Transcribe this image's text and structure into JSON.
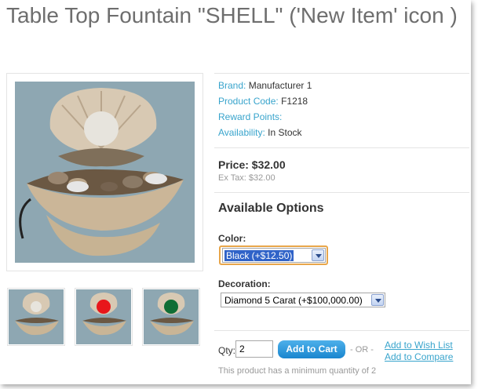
{
  "product": {
    "title": "Table Top Fountain \"SHELL\" ('New Item' icon )",
    "details": [
      {
        "key": "Brand:",
        "value": "Manufacturer 1"
      },
      {
        "key": "Product Code:",
        "value": "F1218"
      },
      {
        "key": "Reward Points:",
        "value": ""
      },
      {
        "key": "Availability:",
        "value": "In Stock"
      }
    ],
    "price_label": "Price: $32.00",
    "ex_tax": "Ex Tax: $32.00"
  },
  "options": {
    "heading": "Available Options",
    "color_label": "Color:",
    "color_value": "Black (+$12.50)",
    "decoration_label": "Decoration:",
    "decoration_value": "Diamond 5 Carat (+$100,000.00)"
  },
  "thumbnails": [
    {
      "marker": "none"
    },
    {
      "marker": "#e8161b"
    },
    {
      "marker": "#0f6e35"
    }
  ],
  "cart": {
    "qty_label": "Qty:",
    "qty_value": "2",
    "add_button": "Add to Cart",
    "or_text": "- OR -",
    "wishlist": "Add to Wish List",
    "compare": "Add to Compare",
    "minimum_note": "This product has a minimum quantity of 2"
  }
}
